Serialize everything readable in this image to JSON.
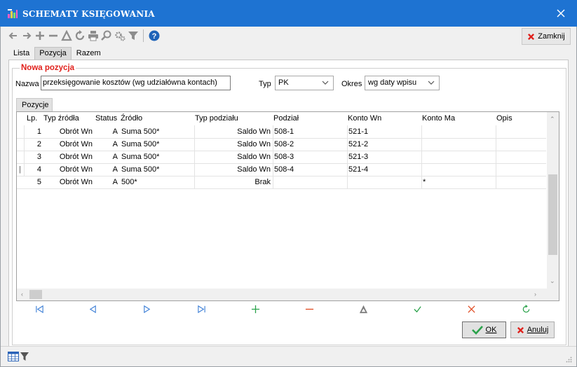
{
  "window": {
    "title": "SCHEMATY KSIĘGOWANIA",
    "close_glyph": "✕"
  },
  "toolbar": {
    "icons": [
      "arrow-left-icon",
      "arrow-right-icon",
      "plus-icon",
      "minus-icon",
      "triangle-icon",
      "refresh-icon",
      "print-icon",
      "search-icon",
      "settings-icon",
      "filter-icon",
      "help-icon"
    ],
    "close_label": "Zamknij"
  },
  "tabs": [
    {
      "label": "Lista",
      "active": false
    },
    {
      "label": "Pozycja",
      "active": true
    },
    {
      "label": "Razem",
      "active": false
    }
  ],
  "form": {
    "group_title": "Nowa pozycja",
    "nazwa_label": "Nazwa",
    "nazwa_value": "przeksięgowanie kosztów (wg udziałówna kontach)",
    "typ_label": "Typ",
    "typ_value": "PK",
    "okres_label": "Okres",
    "okres_value": "wg daty wpisu"
  },
  "subtab": {
    "label": "Pozycje"
  },
  "grid": {
    "columns": [
      "Lp.",
      "Typ źródła",
      "Status",
      "Źródło",
      "Typ podziału",
      "Podział",
      "Konto Wn",
      "Konto Ma",
      "Opis"
    ],
    "rows": [
      {
        "lp": "1",
        "typ_zrodla": "Obrót Wn",
        "status": "A",
        "zrodlo": "Suma 500*",
        "typ_podzialu": "Saldo Wn",
        "podzial": "508-1",
        "konto_wn": "521-1",
        "konto_ma": "",
        "opis": "",
        "marker": ""
      },
      {
        "lp": "2",
        "typ_zrodla": "Obrót Wn",
        "status": "A",
        "zrodlo": "Suma 500*",
        "typ_podzialu": "Saldo Wn",
        "podzial": "508-2",
        "konto_wn": "521-2",
        "konto_ma": "",
        "opis": "",
        "marker": ""
      },
      {
        "lp": "3",
        "typ_zrodla": "Obrót Wn",
        "status": "A",
        "zrodlo": "Suma 500*",
        "typ_podzialu": "Saldo Wn",
        "podzial": "508-3",
        "konto_wn": "521-3",
        "konto_ma": "",
        "opis": "",
        "marker": ""
      },
      {
        "lp": "4",
        "typ_zrodla": "Obrót Wn",
        "status": "A",
        "zrodlo": "Suma 500*",
        "typ_podzialu": "Saldo Wn",
        "podzial": "508-4",
        "konto_wn": "521-4",
        "konto_ma": "",
        "opis": "",
        "marker": "|"
      },
      {
        "lp": "5",
        "typ_zrodla": "Obrót Wn",
        "status": "A",
        "zrodlo": "500*",
        "typ_podzialu": "Brak",
        "podzial": "",
        "konto_wn": "",
        "konto_ma": "*",
        "opis": "",
        "marker": ""
      }
    ]
  },
  "navigator": {
    "icons": [
      "first-record-icon",
      "prev-record-icon",
      "next-record-icon",
      "last-record-icon",
      "add-record-icon",
      "delete-record-icon",
      "edit-record-icon",
      "post-record-icon",
      "cancel-record-icon",
      "refresh-record-icon"
    ]
  },
  "buttons": {
    "ok_label": "OK",
    "cancel_label": "Anuluj"
  },
  "colors": {
    "titlebar": "#1e73d2",
    "legend_red": "#e0201b",
    "nav_blue": "#3d7fd6",
    "nav_green": "#2aa24a",
    "nav_red": "#e0481e"
  }
}
